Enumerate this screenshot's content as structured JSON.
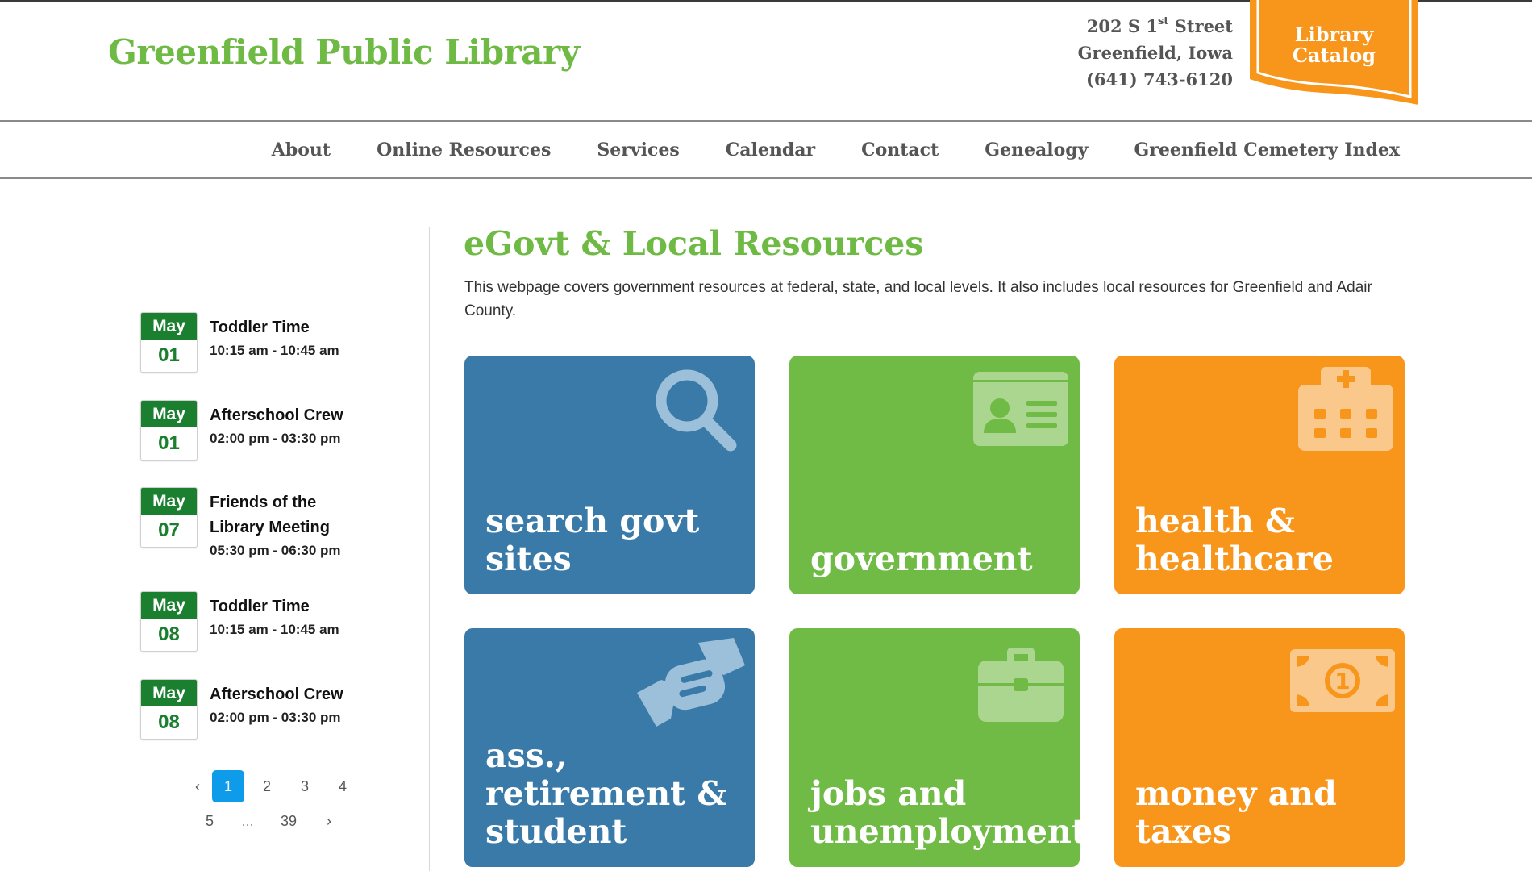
{
  "header": {
    "site_title": "Greenfield Public Library",
    "address_line1_prefix": "202 S 1",
    "address_line1_sup": "st",
    "address_line1_suffix": " Street",
    "address_line2": "Greenfield, Iowa",
    "phone": "(641) 743-6120",
    "catalog_line1": "Library",
    "catalog_line2": "Catalog"
  },
  "nav": {
    "items": [
      {
        "label": "About"
      },
      {
        "label": "Online Resources"
      },
      {
        "label": "Services"
      },
      {
        "label": "Calendar"
      },
      {
        "label": "Contact"
      },
      {
        "label": "Genealogy"
      },
      {
        "label": "Greenfield Cemetery Index"
      }
    ]
  },
  "events": [
    {
      "month": "May",
      "day": "01",
      "title": "Toddler Time",
      "time": "10:15 am - 10:45 am"
    },
    {
      "month": "May",
      "day": "01",
      "title": "Afterschool Crew",
      "time": "02:00 pm - 03:30 pm"
    },
    {
      "month": "May",
      "day": "07",
      "title": "Friends of the Library Meeting",
      "time": "05:30 pm - 06:30 pm"
    },
    {
      "month": "May",
      "day": "08",
      "title": "Toddler Time",
      "time": "10:15 am - 10:45 am"
    },
    {
      "month": "May",
      "day": "08",
      "title": "Afterschool Crew",
      "time": "02:00 pm - 03:30 pm"
    }
  ],
  "pagination": {
    "prev": "‹",
    "next": "›",
    "pages": [
      "1",
      "2",
      "3",
      "4",
      "5"
    ],
    "ellipsis": "...",
    "last": "39",
    "current": "1"
  },
  "main": {
    "title": "eGovt & Local Resources",
    "intro": "This webpage covers government resources at federal, state, and local levels. It also includes local resources for Greenfield and Adair County."
  },
  "tiles": [
    {
      "label": "search govt sites",
      "icon": "magnifier-icon",
      "color": "#3a7aa8"
    },
    {
      "label": "government",
      "icon": "id-card-icon",
      "color": "#70ba46"
    },
    {
      "label": "health & healthcare",
      "icon": "hospital-icon",
      "color": "#f8961c"
    },
    {
      "label": "ass., retirement & student",
      "icon": "handshake-icon",
      "color": "#3a7aa8"
    },
    {
      "label": "jobs and unemployment",
      "icon": "briefcase-icon",
      "color": "#70ba46"
    },
    {
      "label": "money and taxes",
      "icon": "money-bill-icon",
      "color": "#f8961c"
    }
  ],
  "colors": {
    "brand_green": "#6fba44",
    "event_green": "#1a7f2e",
    "tile_blue": "#3a7aa8",
    "tile_green": "#70ba46",
    "tile_orange": "#f8961c",
    "pager_active": "#0d9bea"
  }
}
